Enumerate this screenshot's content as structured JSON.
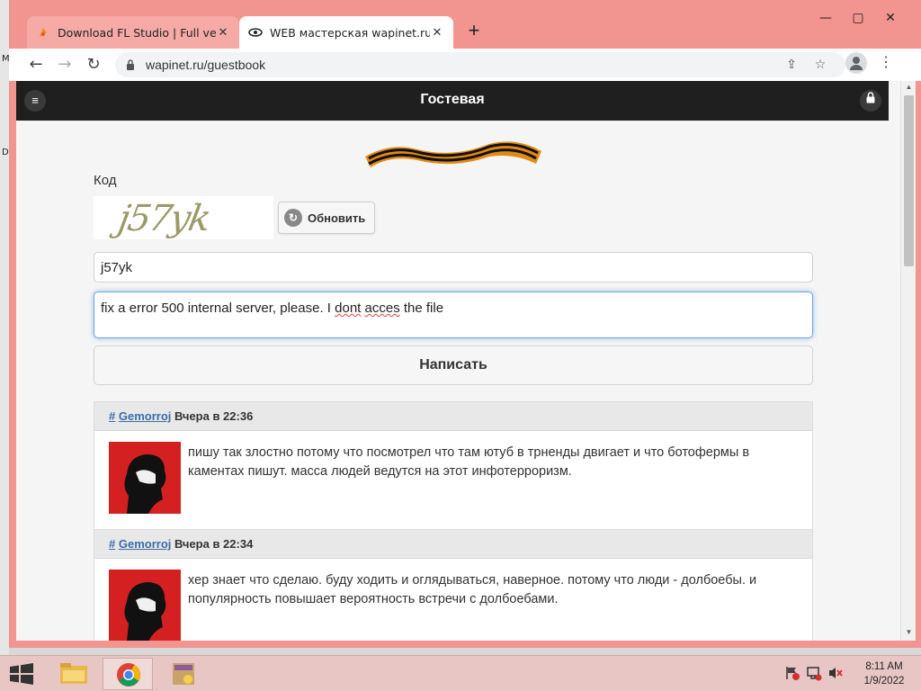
{
  "browser": {
    "tabs": [
      {
        "title": "Download FL Studio | Full version",
        "active": false
      },
      {
        "title": "WEB мастерская wapinet.ru - Гос",
        "active": true
      }
    ],
    "new_tab": "+",
    "url": "wapinet.ru/guestbook",
    "controls": {
      "minimize": "—",
      "maximize": "▢",
      "close": "✕"
    }
  },
  "site": {
    "header_title": "Гостевая",
    "code_label": "Код",
    "captcha_text": "j57yk",
    "refresh_label": "Обновить",
    "code_input_value": "j57yk",
    "message_prefix": "fix a error 500 internal server, please.  I ",
    "message_word1": "dont",
    "message_sep": " ",
    "message_word2": "acces",
    "message_suffix": " the file",
    "submit_label": "Написать"
  },
  "posts": [
    {
      "hash": "#",
      "author": "Gemorroj",
      "time": "Вчера в 22:36",
      "text": "пишу так злостно потому что посмотрел что там ютуб в трненды двигает и что ботофермы в каментах пишут. масса людей ведутся на этот инфотерроризм."
    },
    {
      "hash": "#",
      "author": "Gemorroj",
      "time": "Вчера в 22:34",
      "text": "хер знает что сделаю. буду ходить и оглядываться, наверное. потому что люди - долбоебы. и популярность повышает вероятность встречи с долбоебами."
    }
  ],
  "desktop": {
    "left_glyph_1": "M",
    "left_glyph_2": "D"
  },
  "taskbar": {
    "time": "8:11 AM",
    "date": "1/9/2022"
  },
  "colors": {
    "window_frame": "#f2948f",
    "header_bg": "#1f1f1f",
    "link": "#3b6ea8",
    "taskbar": "#e8c6c4"
  }
}
